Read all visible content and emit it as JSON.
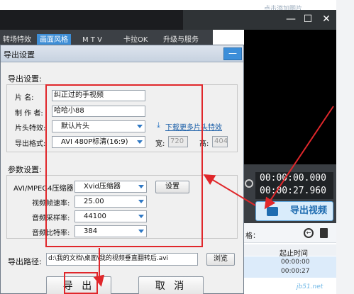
{
  "background_window": {
    "hint_text": "点击添加图片",
    "window_controls": [
      "—",
      "☐",
      "✕"
    ],
    "tabs": [
      "转场特效",
      "画面风格",
      "M T V",
      "卡拉OK",
      "升级与服务"
    ],
    "timecode": {
      "current": "00:00:00.000",
      "total": "00:00:27.960"
    },
    "export_video_label": "导出视频",
    "list": {
      "col_name": "格：",
      "col_start": "起止时间",
      "rows": [
        [
          "00:00:00",
          "00:00:27"
        ],
        [
          "00:00:00",
          "00:00:27"
        ]
      ]
    },
    "watermark": "jb51.net"
  },
  "dialog": {
    "title": "导出设置",
    "minimize_label": "—",
    "export_settings": {
      "section_label": "导出设置:",
      "title_label": "片    名:",
      "title_value": "纠正过的手视频",
      "author_label": "制 作 者:",
      "author_value": "哈哈小88",
      "intro_label": "片头特效:",
      "intro_value": "默认片头",
      "download_link": "下载更多片头特效",
      "format_label": "导出格式:",
      "format_value": "AVI 480P标清(16:9)",
      "width_label": "宽:",
      "width_value": "720",
      "height_label": "高:",
      "height_value": "404"
    },
    "params": {
      "section_label": "参数设置:",
      "codec_label": "AVI/MPEG4压缩器",
      "codec_value": "Xvid压缩器",
      "settings_button": "设置",
      "fps_label": "视频帧速率:",
      "fps_value": "25.00",
      "sample_rate_label": "音频采样率:",
      "sample_rate_value": "44100",
      "bitrate_label": "音频比特率:",
      "bitrate_value": "384"
    },
    "output": {
      "path_label": "导出路径:",
      "path_value": "d:\\我的文档\\桌面\\我的视频垂直翻转后.avi",
      "browse_button": "浏览"
    },
    "export_button": "导 出",
    "cancel_button": "取 消"
  }
}
